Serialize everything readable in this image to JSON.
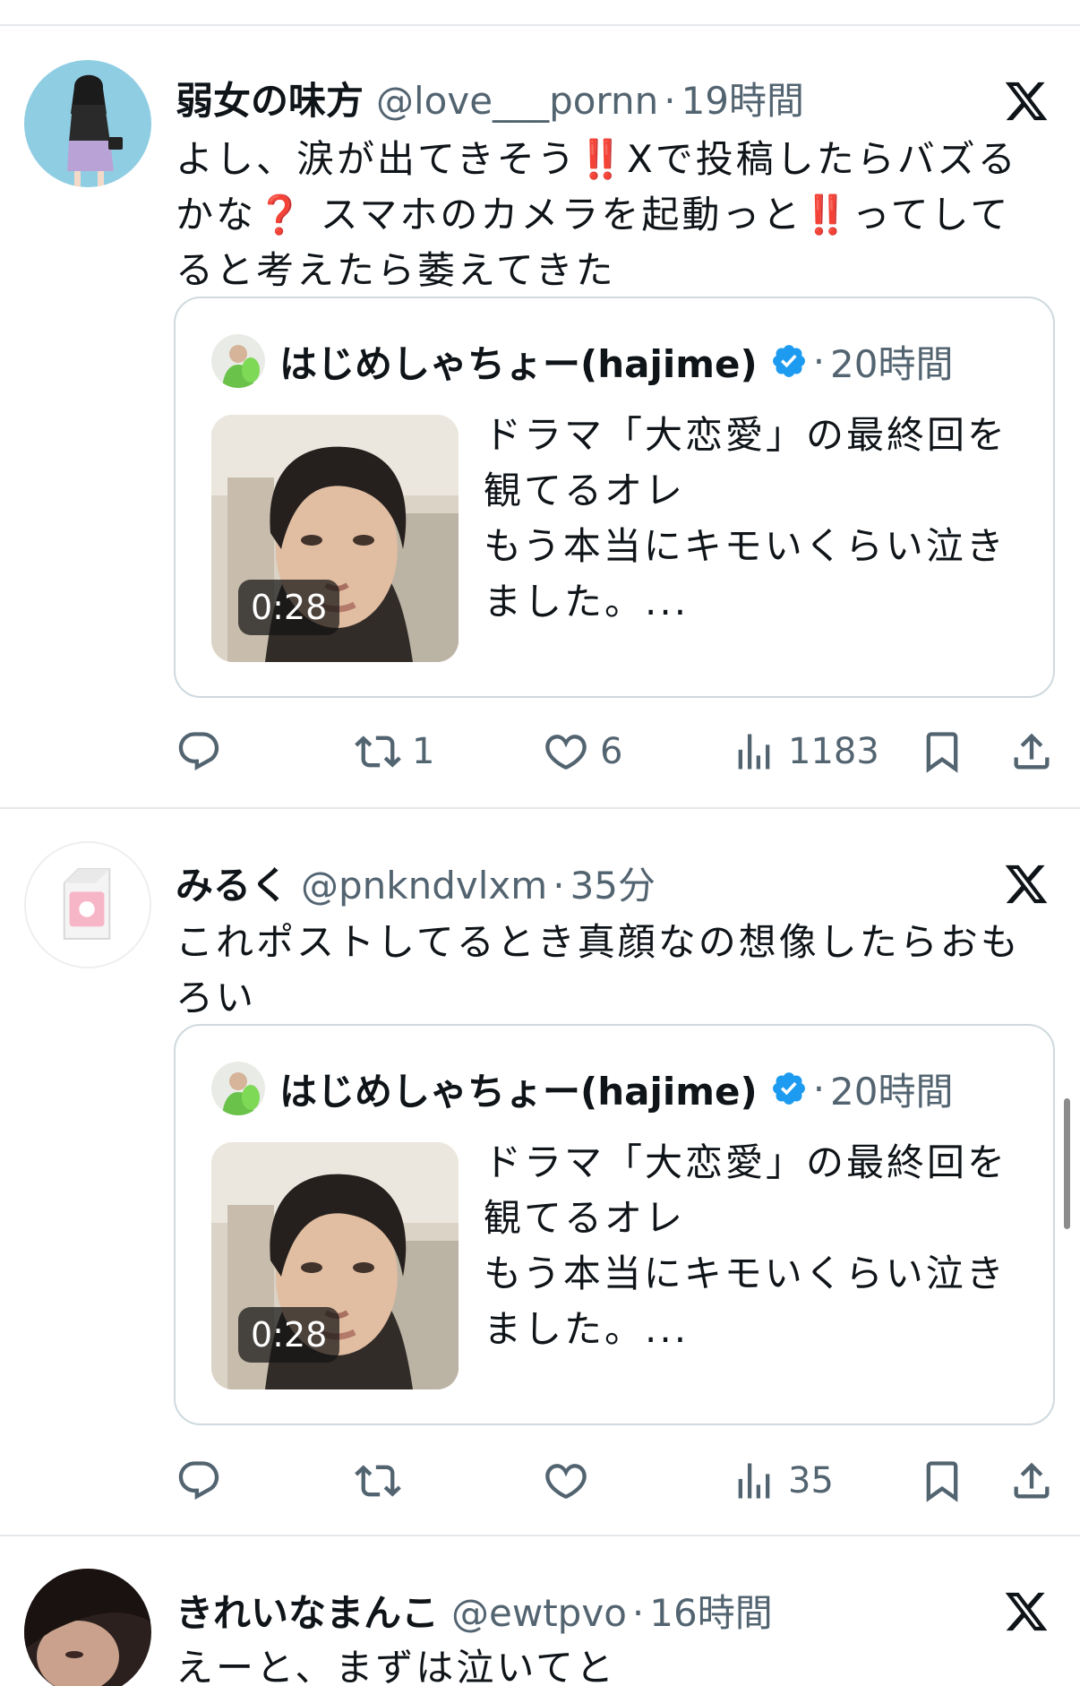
{
  "tweets": [
    {
      "display_name": "弱女の味方",
      "handle": "@love___pornn",
      "separator": "·",
      "time": "19時間",
      "text": "よし、涙が出てきそう‼️Xで投稿したらバズるかな❓ スマホのカメラを起動っと‼️ってしてると考えたら萎えてきた",
      "quote": {
        "display_name": "はじめしゃちょー(hajime)",
        "separator": "·",
        "time": "20時間",
        "duration": "0:28",
        "text": "ドラマ「大恋愛」の最終回を観てるオレ\nもう本当にキモいくらい泣きました。..."
      },
      "actions": {
        "replies": "",
        "reposts": "1",
        "likes": "6",
        "views": "1183"
      }
    },
    {
      "display_name": "みるく",
      "handle": "@pnkndvlxm",
      "separator": "·",
      "time": "35分",
      "text": "これポストしてるとき真顔なの想像したらおもろい",
      "quote": {
        "display_name": "はじめしゃちょー(hajime)",
        "separator": "·",
        "time": "20時間",
        "duration": "0:28",
        "text": "ドラマ「大恋愛」の最終回を観てるオレ\nもう本当にキモいくらい泣きました。..."
      },
      "actions": {
        "replies": "",
        "reposts": "",
        "likes": "",
        "views": "35"
      }
    },
    {
      "display_name": "きれいなまんこ",
      "handle": "@ewtpvo",
      "separator": "·",
      "time": "16時間",
      "text": "えーと、まずは泣いてと"
    }
  ],
  "icons": {
    "reply": "reply-icon",
    "repost": "repost-icon",
    "like": "heart-icon",
    "views": "views-icon",
    "bookmark": "bookmark-icon",
    "share": "share-icon",
    "brand": "x-logo-icon",
    "verified": "verified-badge-icon"
  },
  "colors": {
    "text": "#0f1419",
    "secondary": "#536471",
    "divider": "#e6e9ec",
    "card_border": "#cfd9de",
    "verified": "#1d9bf0"
  }
}
